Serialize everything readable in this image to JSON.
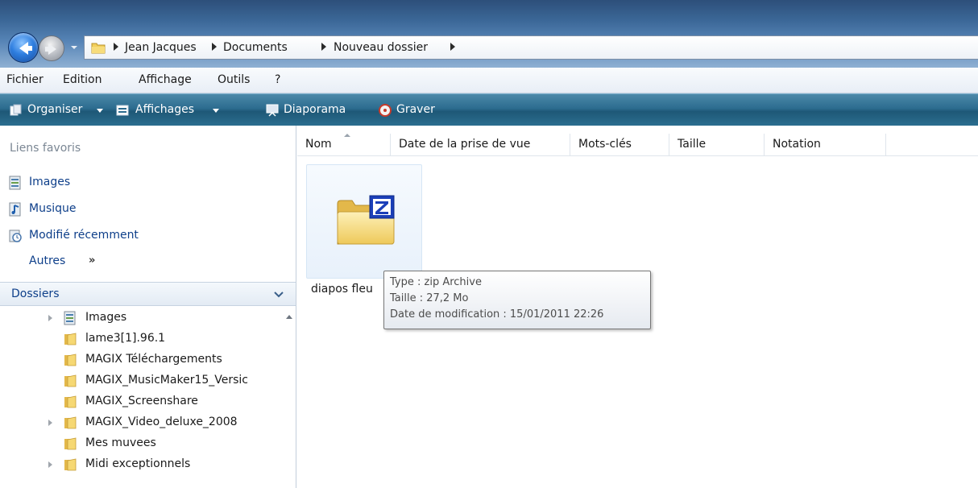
{
  "address_bar": {
    "breadcrumbs": [
      "Jean Jacques",
      "Documents",
      "Nouveau dossier"
    ]
  },
  "menu": {
    "items": [
      "Fichier",
      "Edition",
      "Affichage",
      "Outils",
      "?"
    ]
  },
  "command_bar": {
    "organiser": "Organiser",
    "affichages": "Affichages",
    "diaporama": "Diaporama",
    "graver": "Graver"
  },
  "nav_pane": {
    "favorites_header": "Liens favoris",
    "favorites": [
      {
        "label": "Images",
        "icon": "images-icon"
      },
      {
        "label": "Musique",
        "icon": "music-icon"
      },
      {
        "label": "Modifié récemment",
        "icon": "recent-icon"
      }
    ],
    "more_label": "Autres",
    "more_chevron": "»",
    "folders_header": "Dossiers",
    "tree": [
      {
        "label": "Images",
        "expandable": true,
        "icon": "images-folder-icon"
      },
      {
        "label": "lame3[1].96.1",
        "expandable": false,
        "icon": "folder-icon"
      },
      {
        "label": "MAGIX Téléchargements",
        "expandable": false,
        "icon": "folder-icon"
      },
      {
        "label": "MAGIX_MusicMaker15_Versic",
        "expandable": false,
        "icon": "folder-icon"
      },
      {
        "label": "MAGIX_Screenshare",
        "expandable": false,
        "icon": "folder-icon"
      },
      {
        "label": "MAGIX_Video_deluxe_2008",
        "expandable": true,
        "icon": "folder-icon"
      },
      {
        "label": "Mes muvees",
        "expandable": false,
        "icon": "folder-icon"
      },
      {
        "label": "Midi exceptionnels",
        "expandable": true,
        "icon": "folder-icon"
      }
    ]
  },
  "columns": [
    "Nom",
    "Date de la prise de vue",
    "Mots-clés",
    "Taille",
    "Notation"
  ],
  "file": {
    "name": "diapos fleu",
    "icon": "zip-folder-icon"
  },
  "tooltip": {
    "type": "Type : zip Archive",
    "size": "Taille : 27,2 Mo",
    "modified": "Date de modification : 15/01/2011 22:26"
  },
  "colors": {
    "command_bar": "#2c6c8f",
    "link": "#0e3f8a",
    "address_gradient_top": "#2d4f7a"
  }
}
